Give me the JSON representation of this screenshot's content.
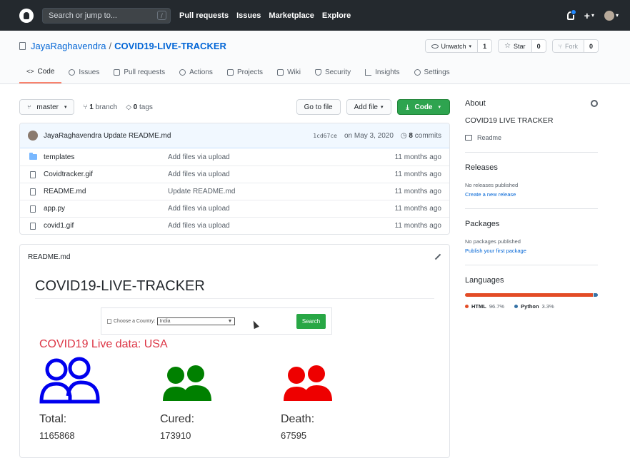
{
  "header": {
    "search_placeholder": "Search or jump to...",
    "search_key": "/",
    "nav": [
      "Pull requests",
      "Issues",
      "Marketplace",
      "Explore"
    ],
    "plus": "+",
    "caret": "▾"
  },
  "repo": {
    "owner": "JayaRaghavendra",
    "separator": "/",
    "name": "COVID19-LIVE-TRACKER",
    "watch_label": "Unwatch",
    "watch_count": "1",
    "star_label": "Star",
    "star_count": "0",
    "fork_label": "Fork",
    "fork_count": "0"
  },
  "tabs": [
    "Code",
    "Issues",
    "Pull requests",
    "Actions",
    "Projects",
    "Wiki",
    "Security",
    "Insights",
    "Settings"
  ],
  "toolbar": {
    "branch": "master",
    "branches_count": "1",
    "branches_label": "branch",
    "tags_count": "0",
    "tags_label": "tags",
    "go_to_file": "Go to file",
    "add_file": "Add file",
    "code": "Code"
  },
  "latest_commit": {
    "author": "JayaRaghavendra",
    "message": "Update README.md",
    "sha": "1cd67ce",
    "date": "on May 3, 2020",
    "commits_count": "8",
    "commits_label": "commits"
  },
  "files": [
    {
      "name": "templates",
      "message": "Add files via upload",
      "age": "11 months ago",
      "type": "folder"
    },
    {
      "name": "Covidtracker.gif",
      "message": "Add files via upload",
      "age": "11 months ago",
      "type": "file"
    },
    {
      "name": "README.md",
      "message": "Update README.md",
      "age": "11 months ago",
      "type": "file"
    },
    {
      "name": "app.py",
      "message": "Add files via upload",
      "age": "11 months ago",
      "type": "file"
    },
    {
      "name": "covid1.gif",
      "message": "Add files via upload",
      "age": "11 months ago",
      "type": "file"
    }
  ],
  "readme": {
    "filename": "README.md",
    "heading": "COVID19-LIVE-TRACKER",
    "demo": {
      "country_label": "Choose a Country:",
      "country_value": "India",
      "search_button": "Search",
      "live_title": "COVID19 Live data: USA",
      "stats": [
        {
          "label": "Total:",
          "value": "1165868",
          "color": "#0000ee",
          "style": "outline"
        },
        {
          "label": "Cured:",
          "value": "173910",
          "color": "#008000",
          "style": "solid"
        },
        {
          "label": "Death:",
          "value": "67595",
          "color": "#ee0000",
          "style": "solid"
        }
      ]
    }
  },
  "sidebar": {
    "about_title": "About",
    "description": "COVID19 LIVE TRACKER",
    "readme_label": "Readme",
    "releases_title": "Releases",
    "no_releases": "No releases published",
    "create_release": "Create a new release",
    "packages_title": "Packages",
    "no_packages": "No packages published",
    "publish_package": "Publish your first package",
    "languages_title": "Languages",
    "languages": [
      {
        "name": "HTML",
        "percent": "96.7%",
        "share": 96.7,
        "color": "#e34c26"
      },
      {
        "name": "Python",
        "percent": "3.3%",
        "share": 3.3,
        "color": "#3572A5"
      }
    ]
  }
}
